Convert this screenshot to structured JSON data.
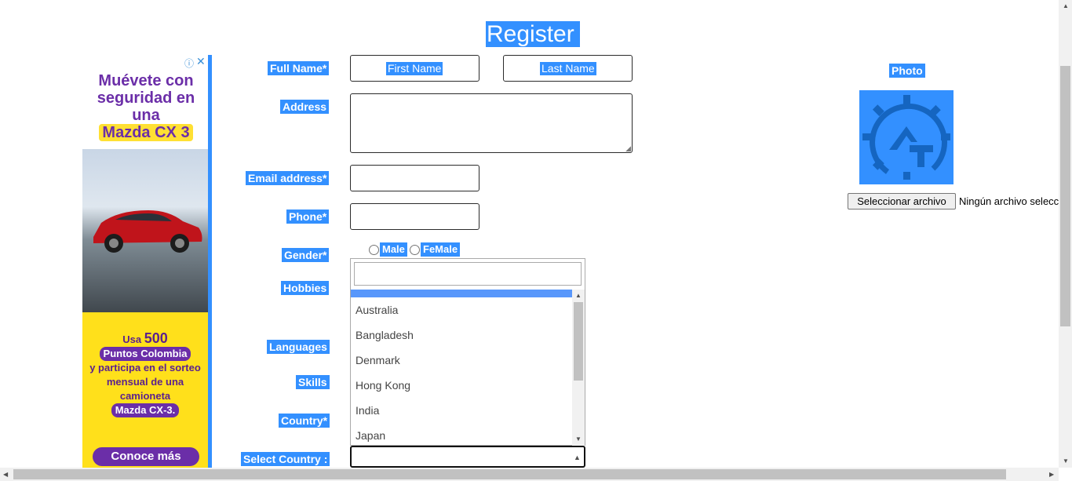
{
  "page": {
    "title": "Register"
  },
  "ad": {
    "headline": "Muévete con seguridad en una",
    "model": "Mazda CX 3",
    "promo_line1": "Usa",
    "promo_points": "500",
    "promo_brand": "Puntos Colombia",
    "promo_line2": "y participa en el sorteo mensual de una camioneta",
    "promo_model": "Mazda CX-3.",
    "cta": "Conoce más",
    "info_icon": "info-icon",
    "close_icon": "close-icon"
  },
  "form": {
    "full_name": {
      "label": "Full Name*",
      "first_placeholder": "First Name",
      "last_placeholder": "Last Name"
    },
    "address": {
      "label": "Address"
    },
    "email": {
      "label": "Email address*"
    },
    "phone": {
      "label": "Phone*"
    },
    "gender": {
      "label": "Gender*",
      "options": [
        "Male",
        "FeMale"
      ]
    },
    "hobbies": {
      "label": "Hobbies"
    },
    "languages": {
      "label": "Languages"
    },
    "skills": {
      "label": "Skills"
    },
    "country": {
      "label": "Country*"
    },
    "select_country": {
      "label": "Select Country :"
    }
  },
  "dropdown": {
    "search_value": "",
    "options": [
      "Australia",
      "Bangladesh",
      "Denmark",
      "Hong Kong",
      "India",
      "Japan"
    ]
  },
  "photo": {
    "label": "Photo",
    "file_button": "Seleccionar archivo",
    "file_status": "Ningún archivo seleccionado"
  },
  "colors": {
    "selection": "#3390ff",
    "dropdown_highlight": "#5897fb",
    "ad_purple": "#6b2ea8",
    "ad_yellow": "#ffe01b"
  }
}
